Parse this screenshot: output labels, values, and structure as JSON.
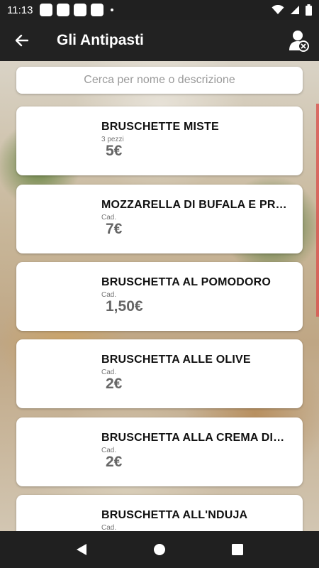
{
  "status_bar": {
    "time": "11:13"
  },
  "app_bar": {
    "title": "Gli Antipasti"
  },
  "search": {
    "placeholder": "Cerca per nome o descrizione"
  },
  "items": [
    {
      "name": "BRUSCHETTE MISTE",
      "unit": "3 pezzi",
      "price": "5€"
    },
    {
      "name": "MOZZARELLA DI BUFALA E PROSCIUTTO",
      "unit": "Cad.",
      "price": "7€"
    },
    {
      "name": "BRUSCHETTA AL POMODORO",
      "unit": "Cad.",
      "price": "1,50€"
    },
    {
      "name": "BRUSCHETTA ALLE OLIVE",
      "unit": "Cad.",
      "price": "2€"
    },
    {
      "name": "BRUSCHETTA ALLA CREMA DI CARCIOFI",
      "unit": "Cad.",
      "price": "2€"
    },
    {
      "name": "BRUSCHETTA ALL'NDUJA",
      "unit": "Cad.",
      "price": ""
    }
  ],
  "icons": {
    "back": "arrow-back-icon",
    "profile": "user-remove-icon",
    "wifi": "wifi-icon",
    "signal": "signal-icon",
    "battery": "battery-icon",
    "nav_back": "triangle-back-icon",
    "nav_home": "circle-home-icon",
    "nav_recent": "square-recents-icon"
  },
  "colors": {
    "toolbar": "#222222",
    "status_bar": "#202020",
    "accent": "#d9534f"
  }
}
